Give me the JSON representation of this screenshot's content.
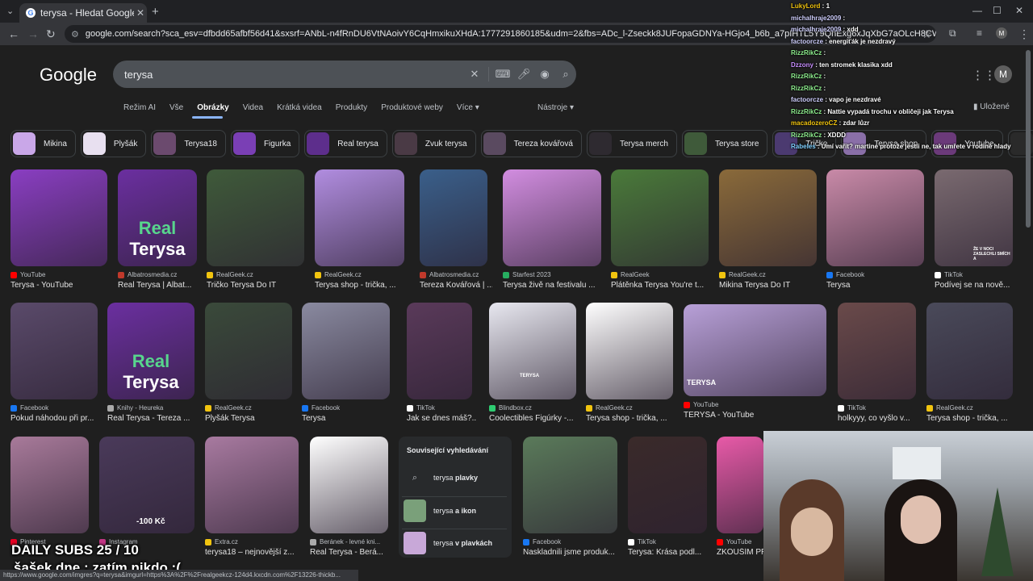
{
  "browser": {
    "tab_title": "terysa - Hledat Googlem",
    "url": "google.com/search?sca_esv=dfbdd65afbf56d41&sxsrf=ANbL-n4fRnDU6VtNAoivY6CqHmxikuXHdA:1777291860185&udm=2&fbs=ADc_l-Zseckk8JUFopaGDNYa-HGjo4_b6b_a7pIHTL5Y9QnExg6xJqXbG7aOLcH8CWqTRCHVzGY6TD4BR4PVzZvFDVU0-Jk...",
    "status_url": "https://www.google.com/imgres?q=terysa&imgurl=https%3A%2F%2Frealgeekcz-124d4.kxcdn.com%2F13226-thickb..."
  },
  "google": {
    "logo": "Google",
    "query": "terysa",
    "avatar": "M",
    "saved_label": "Uložené",
    "tools_label": "Nástroje",
    "tabs": [
      "Režim AI",
      "Vše",
      "Obrázky",
      "Videa",
      "Krátká videa",
      "Produkty",
      "Produktové weby",
      "Více"
    ]
  },
  "chips": [
    {
      "label": "Mikina",
      "color": "#c9a7e8"
    },
    {
      "label": "Plyšák",
      "color": "#e8e0f0"
    },
    {
      "label": "Terysa18",
      "color": "#6b4a6e"
    },
    {
      "label": "Figurka",
      "color": "#7a3fb5"
    },
    {
      "label": "Real terysa",
      "color": "#5d2e8c"
    },
    {
      "label": "Zvuk terysa",
      "color": "#4a3a45"
    },
    {
      "label": "Tereza kovářová",
      "color": "#5a4a60"
    },
    {
      "label": "Terysa merch",
      "color": "#2e2a30"
    },
    {
      "label": "Terysa store",
      "color": "#3f5a3a"
    },
    {
      "label": "Tričko",
      "color": "#4b3a70"
    },
    {
      "label": "Terysa shop",
      "color": "#8a6fa8"
    },
    {
      "label": "Youtube",
      "color": "#6b3a7a"
    },
    {
      "label": "Youtube",
      "color": "#2a2a2a"
    }
  ],
  "results": [
    {
      "src": "YouTube",
      "cap": "Terysa - YouTube",
      "color": "#8a3ec2",
      "srccolor": "#ff0000"
    },
    {
      "src": "Albatrosmedia.cz",
      "cap": "Real Terysa | Albat...",
      "color": "#6b2fa0",
      "srccolor": "#c0392b"
    },
    {
      "src": "RealGeek.cz",
      "cap": "Tričko Terysa Do IT",
      "color": "#3f5a3a",
      "srccolor": "#f1c40f"
    },
    {
      "src": "RealGeek.cz",
      "cap": "Terysa shop - trička, ...",
      "color": "#b18de0",
      "srccolor": "#f1c40f"
    },
    {
      "src": "Albatrosmedia.cz",
      "cap": "Tereza Kovářová | ...",
      "color": "#3a5f8a",
      "srccolor": "#c0392b"
    },
    {
      "src": "Starfest 2023",
      "cap": "Terysa živě na festivalu ...",
      "color": "#d28de0",
      "srccolor": "#27ae60"
    },
    {
      "src": "RealGeek",
      "cap": "Plátěnka Terysa You're t...",
      "color": "#4a7a3a",
      "srccolor": "#f1c40f"
    },
    {
      "src": "RealGeek.cz",
      "cap": "Mikina Terysa Do IT",
      "color": "#8a6a3a",
      "srccolor": "#f1c40f"
    },
    {
      "src": "Facebook",
      "cap": "Terysa",
      "color": "#c98aa8",
      "srccolor": "#1877f2"
    },
    {
      "src": "TikTok",
      "cap": "Podívej se na nově...",
      "color": "#7a6a70",
      "srccolor": "#ffffff"
    },
    {
      "src": "Facebook",
      "cap": "Pokud náhodou při pr...",
      "color": "#5a4a6a",
      "srccolor": "#1877f2"
    },
    {
      "src": "Knihy - Heureka",
      "cap": "Real Terysa - Tereza ...",
      "color": "#6b2fa0",
      "srccolor": "#aaaaaa"
    },
    {
      "src": "RealGeek.cz",
      "cap": "Plyšák Terysa",
      "color": "#3a4a3a",
      "srccolor": "#f1c40f"
    },
    {
      "src": "Facebook",
      "cap": "Terysa",
      "color": "#8a8aa0",
      "srccolor": "#1877f2"
    },
    {
      "src": "TikTok",
      "cap": "Jak se dnes máš?...",
      "color": "#5a3a5a",
      "srccolor": "#ffffff"
    },
    {
      "src": "Blindbox.cz",
      "cap": "Coolectibles Figúrky -...",
      "color": "#e8e8f0",
      "srccolor": "#2ecc71"
    },
    {
      "src": "RealGeek.cz",
      "cap": "Terysa shop - trička, ...",
      "color": "#ffffff",
      "srccolor": "#f1c40f"
    },
    {
      "src": "YouTube",
      "cap": "TERYSA - YouTube",
      "color": "#b8a0d8",
      "srccolor": "#ff0000"
    },
    {
      "src": "TikTok",
      "cap": "holkyyy, co vyšlo v...",
      "color": "#6a4a4a",
      "srccolor": "#ffffff"
    },
    {
      "src": "RealGeek.cz",
      "cap": "Terysa shop - trička, ...",
      "color": "#4a4a5a",
      "srccolor": "#f1c40f"
    },
    {
      "src": "Pinterest",
      "cap": "",
      "color": "#a87a9a",
      "srccolor": "#e60023"
    },
    {
      "src": "Instagram",
      "cap": "",
      "color": "#4a3a5a",
      "srccolor": "#c13584"
    },
    {
      "src": "Extra.cz",
      "cap": "terysa18 – nejnovější z...",
      "color": "#a87aa0",
      "srccolor": "#f1c40f"
    },
    {
      "src": "Beránek - levné kni...",
      "cap": "Real Terysa - Berá...",
      "color": "#ffffff",
      "srccolor": "#aaaaaa"
    },
    {
      "src": "Facebook",
      "cap": "Naskladnili jsme produk...",
      "color": "#5a7a5a",
      "srccolor": "#1877f2"
    },
    {
      "src": "TikTok",
      "cap": "Terysa: Krása podl...",
      "color": "#3a2a2a",
      "srccolor": "#ffffff"
    },
    {
      "src": "YouTube",
      "cap": "ZKOUŠÍM PR...",
      "color": "#e85aa8",
      "srccolor": "#ff0000"
    }
  ],
  "overlay_labels": {
    "fig_real": "Real",
    "fig_terysa": "Terysa",
    "price_badge": "-100 Kč",
    "tshirt_tag": "TERYSA",
    "tiktok_badge": "ŽE V NOCI ZASLECHLI SMÍCH A",
    "youtube_badge": "TERYSA"
  },
  "related": {
    "heading": "Související vyhledávání",
    "items": [
      {
        "pre": "terysa ",
        "bold": "plavky"
      },
      {
        "pre": "terysa ",
        "bold": "a ikon"
      },
      {
        "pre": "terysa ",
        "bold": "v plavkách"
      }
    ]
  },
  "chat": [
    {
      "user": "LukyLord",
      "msg": " : 1",
      "color": "#f1c40f"
    },
    {
      "user": "michalhraje2009",
      "msg": " : ",
      "color": "#d0d0ff"
    },
    {
      "user": "michalhraje2009",
      "msg": " : xdd",
      "color": "#d0d0ff"
    },
    {
      "user": "factoorcze",
      "msg": " : energiťák je nezdravý",
      "color": "#d0d0ff"
    },
    {
      "user": "RizzRikCz",
      "msg": " : ",
      "color": "#8ff08f"
    },
    {
      "user": "Dzzony",
      "msg": " : ten stromek klasika xdd",
      "color": "#c88fff"
    },
    {
      "user": "RizzRikCz",
      "msg": " : ",
      "color": "#8ff08f"
    },
    {
      "user": "RizzRikCz",
      "msg": " : ",
      "color": "#8ff08f"
    },
    {
      "user": "factoorcze",
      "msg": " : vapo je nezdravé",
      "color": "#d0d0ff"
    },
    {
      "user": "RizzRikCz",
      "msg": " : Nattie vypadá trochu v obličeji jak Terysa",
      "color": "#8ff08f"
    },
    {
      "user": "macadozeroCZ",
      "msg": " : zdar lůzr",
      "color": "#f1c40f"
    },
    {
      "user": "RizzRikCz",
      "msg": " : XDDD",
      "color": "#8ff08f"
    },
    {
      "user": "Rabeles",
      "msg": " : Umí vařit? martine protože jestli ne, tak umřete v rodině hlady",
      "color": "#7fd0ff"
    }
  ],
  "stream": {
    "subs": "DAILY SUBS 25 / 10",
    "jester": "šašek dne : zatím nikdo :("
  }
}
